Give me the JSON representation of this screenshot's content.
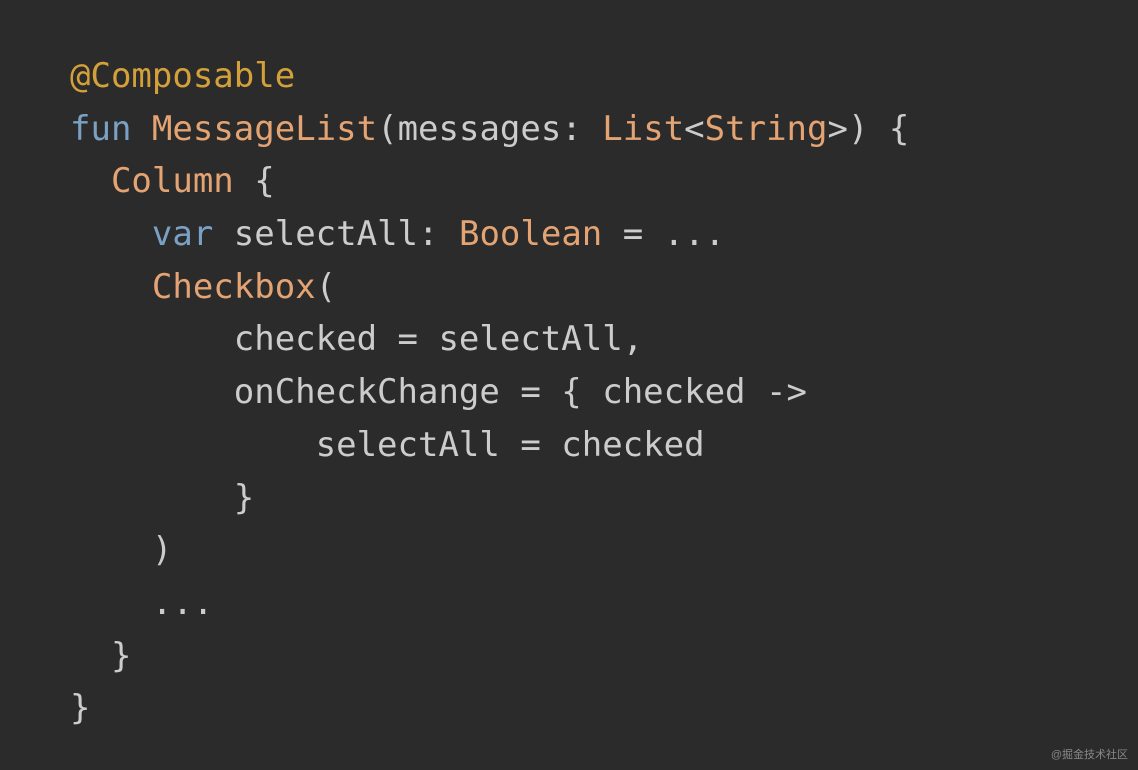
{
  "code": {
    "l1_annotation": "@Composable",
    "l2_fun": "fun",
    "l2_name": "MessageList",
    "l2_paren_open": "(",
    "l2_param": "messages",
    "l2_colon": ": ",
    "l2_type": "List",
    "l2_angle_open": "<",
    "l2_generic": "String",
    "l2_angle_close": ">",
    "l2_paren_close": ")",
    "l2_brace": " {",
    "l3_column": "Column",
    "l3_brace": " {",
    "l4_var": "var",
    "l4_name": " selectAll",
    "l4_colon": ": ",
    "l4_type": "Boolean",
    "l4_eq": " = ...",
    "l5_checkbox": "Checkbox",
    "l5_paren": "(",
    "l6": "checked = selectAll,",
    "l7": "onCheckChange = { checked ->",
    "l8": "selectAll = checked",
    "l9": "}",
    "l10": ")",
    "l11": "...",
    "l12": "}",
    "l13": "}"
  },
  "watermark": "@掘金技术社区"
}
